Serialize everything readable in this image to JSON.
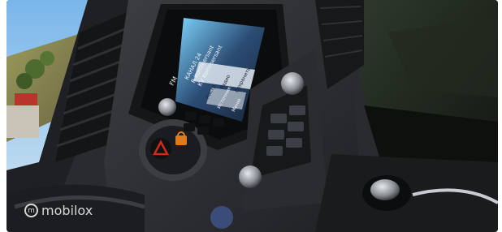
{
  "radio_screen": {
    "band_label": "FM",
    "rows": [
      "КАНАЛ 24",
      "R.Kommersant",
      "KV Kommersant"
    ],
    "buttons": [
      "Настр.",
      "Радио",
      "Сохранить",
      "Источник",
      "Меню"
    ]
  },
  "watermark": {
    "text": "mobilox"
  },
  "colors": {
    "screen_glow": "#7fd7ff",
    "hazard_red": "#d12a1a",
    "accent_orange": "#e07a1b",
    "sky": "#8fc6ee"
  },
  "icons": [
    "hazard-triangle-icon",
    "lock-icon",
    "volume-knob-icon",
    "gear-shifter-icon"
  ]
}
